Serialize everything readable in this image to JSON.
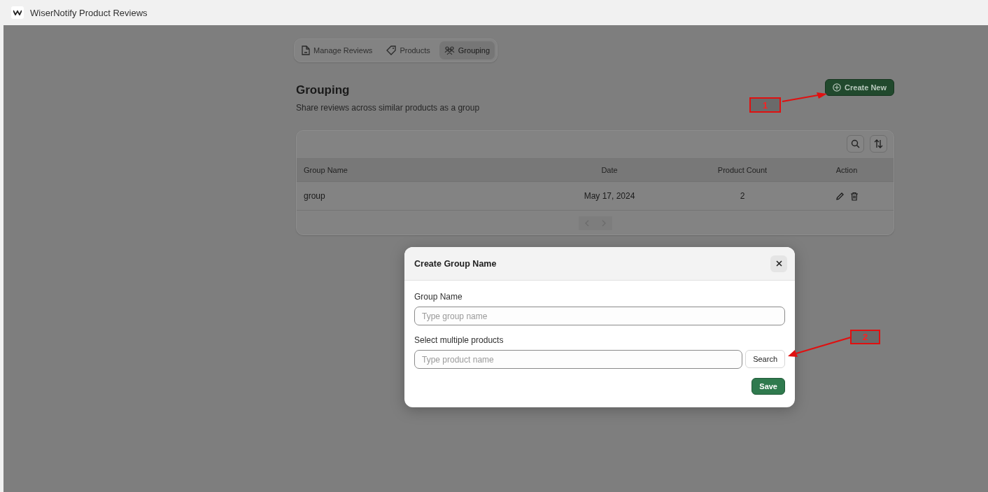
{
  "app_bar": {
    "title": "WiserNotify Product Reviews"
  },
  "tabs": [
    {
      "label": "Manage Reviews",
      "selected": false
    },
    {
      "label": "Products",
      "selected": false
    },
    {
      "label": "Grouping",
      "selected": true
    }
  ],
  "page": {
    "title": "Grouping",
    "subtitle": "Share reviews across similar products as a group",
    "create_button": "Create New"
  },
  "table": {
    "columns": [
      "Group Name",
      "Date",
      "Product Count",
      "Action"
    ],
    "rows": [
      {
        "cells": [
          "group",
          "May 17, 2024",
          "2"
        ]
      }
    ],
    "pagination": {
      "previous_disabled": true,
      "next_disabled": true
    }
  },
  "dialog": {
    "title": "Create Group Name",
    "fields": [
      {
        "label": "Group Name",
        "placeholder": "Type group name"
      },
      {
        "label": "Select multiple products",
        "placeholder": "Type product name"
      }
    ],
    "search_button": "Search",
    "save_button": "Save"
  },
  "annotations": [
    {
      "label": "1"
    },
    {
      "label": "2"
    }
  ]
}
